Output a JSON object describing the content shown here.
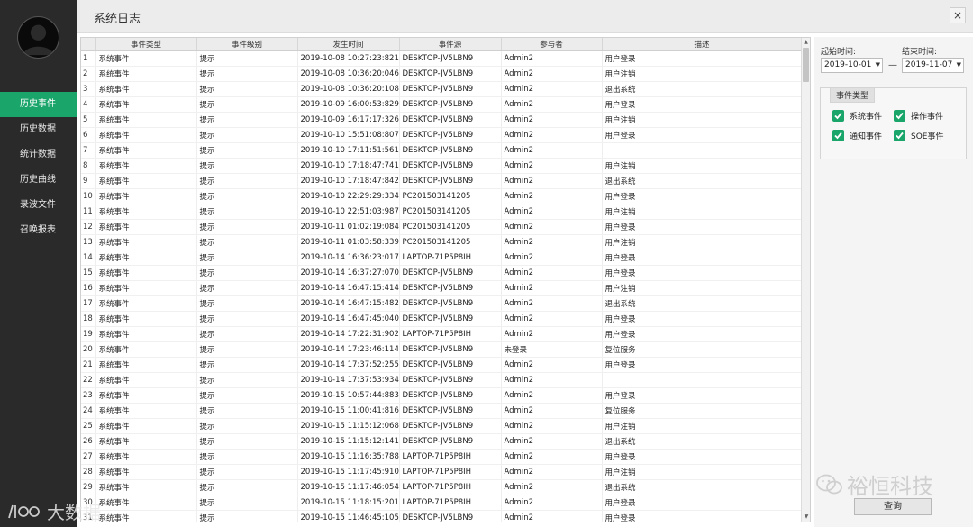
{
  "window": {
    "title": "系统日志",
    "close_label": "×"
  },
  "sidebar": {
    "items": [
      {
        "label": "历史事件",
        "active": true
      },
      {
        "label": "历史数据",
        "active": false
      },
      {
        "label": "统计数据",
        "active": false
      },
      {
        "label": "历史曲线",
        "active": false
      },
      {
        "label": "录波文件",
        "active": false
      },
      {
        "label": "召唤报表",
        "active": false
      }
    ]
  },
  "table": {
    "columns": [
      "事件类型",
      "事件级别",
      "发生时间",
      "事件源",
      "参与者",
      "描述"
    ],
    "rows": [
      [
        "1",
        "系统事件",
        "提示",
        "2019-10-08 10:27:23:821",
        "DESKTOP-JV5LBN9",
        "Admin2",
        "用户登录"
      ],
      [
        "2",
        "系统事件",
        "提示",
        "2019-10-08 10:36:20:046",
        "DESKTOP-JV5LBN9",
        "Admin2",
        "用户注销"
      ],
      [
        "3",
        "系统事件",
        "提示",
        "2019-10-08 10:36:20:108",
        "DESKTOP-JV5LBN9",
        "Admin2",
        "退出系统"
      ],
      [
        "4",
        "系统事件",
        "提示",
        "2019-10-09 16:00:53:829",
        "DESKTOP-JV5LBN9",
        "Admin2",
        "用户登录"
      ],
      [
        "5",
        "系统事件",
        "提示",
        "2019-10-09 16:17:17:326",
        "DESKTOP-JV5LBN9",
        "Admin2",
        "用户注销"
      ],
      [
        "6",
        "系统事件",
        "提示",
        "2019-10-10 15:51:08:807",
        "DESKTOP-JV5LBN9",
        "Admin2",
        "用户登录"
      ],
      [
        "7",
        "系统事件",
        "提示",
        "2019-10-10 17:11:51:561",
        "DESKTOP-JV5LBN9",
        "Admin2",
        ""
      ],
      [
        "8",
        "系统事件",
        "提示",
        "2019-10-10 17:18:47:741",
        "DESKTOP-JV5LBN9",
        "Admin2",
        "用户注销"
      ],
      [
        "9",
        "系统事件",
        "提示",
        "2019-10-10 17:18:47:842",
        "DESKTOP-JV5LBN9",
        "Admin2",
        "退出系统"
      ],
      [
        "10",
        "系统事件",
        "提示",
        "2019-10-10 22:29:29:334",
        "PC201503141205",
        "Admin2",
        "用户登录"
      ],
      [
        "11",
        "系统事件",
        "提示",
        "2019-10-10 22:51:03:987",
        "PC201503141205",
        "Admin2",
        "用户注销"
      ],
      [
        "12",
        "系统事件",
        "提示",
        "2019-10-11 01:02:19:084",
        "PC201503141205",
        "Admin2",
        "用户登录"
      ],
      [
        "13",
        "系统事件",
        "提示",
        "2019-10-11 01:03:58:339",
        "PC201503141205",
        "Admin2",
        "用户注销"
      ],
      [
        "14",
        "系统事件",
        "提示",
        "2019-10-14 16:36:23:017",
        "LAPTOP-71P5P8IH",
        "Admin2",
        "用户登录"
      ],
      [
        "15",
        "系统事件",
        "提示",
        "2019-10-14 16:37:27:070",
        "DESKTOP-JV5LBN9",
        "Admin2",
        "用户登录"
      ],
      [
        "16",
        "系统事件",
        "提示",
        "2019-10-14 16:47:15:414",
        "DESKTOP-JV5LBN9",
        "Admin2",
        "用户注销"
      ],
      [
        "17",
        "系统事件",
        "提示",
        "2019-10-14 16:47:15:482",
        "DESKTOP-JV5LBN9",
        "Admin2",
        "退出系统"
      ],
      [
        "18",
        "系统事件",
        "提示",
        "2019-10-14 16:47:45:040",
        "DESKTOP-JV5LBN9",
        "Admin2",
        "用户登录"
      ],
      [
        "19",
        "系统事件",
        "提示",
        "2019-10-14 17:22:31:902",
        "LAPTOP-71P5P8IH",
        "Admin2",
        "用户登录"
      ],
      [
        "20",
        "系统事件",
        "提示",
        "2019-10-14 17:23:46:114",
        "DESKTOP-JV5LBN9",
        "未登录",
        "复位服务"
      ],
      [
        "21",
        "系统事件",
        "提示",
        "2019-10-14 17:37:52:255",
        "DESKTOP-JV5LBN9",
        "Admin2",
        "用户登录"
      ],
      [
        "22",
        "系统事件",
        "提示",
        "2019-10-14 17:37:53:934",
        "DESKTOP-JV5LBN9",
        "Admin2",
        ""
      ],
      [
        "23",
        "系统事件",
        "提示",
        "2019-10-15 10:57:44:883",
        "DESKTOP-JV5LBN9",
        "Admin2",
        "用户登录"
      ],
      [
        "24",
        "系统事件",
        "提示",
        "2019-10-15 11:00:41:816",
        "DESKTOP-JV5LBN9",
        "Admin2",
        "复位服务"
      ],
      [
        "25",
        "系统事件",
        "提示",
        "2019-10-15 11:15:12:068",
        "DESKTOP-JV5LBN9",
        "Admin2",
        "用户注销"
      ],
      [
        "26",
        "系统事件",
        "提示",
        "2019-10-15 11:15:12:141",
        "DESKTOP-JV5LBN9",
        "Admin2",
        "退出系统"
      ],
      [
        "27",
        "系统事件",
        "提示",
        "2019-10-15 11:16:35:788",
        "LAPTOP-71P5P8IH",
        "Admin2",
        "用户登录"
      ],
      [
        "28",
        "系统事件",
        "提示",
        "2019-10-15 11:17:45:910",
        "LAPTOP-71P5P8IH",
        "Admin2",
        "用户注销"
      ],
      [
        "29",
        "系统事件",
        "提示",
        "2019-10-15 11:17:46:054",
        "LAPTOP-71P5P8IH",
        "Admin2",
        "退出系统"
      ],
      [
        "30",
        "系统事件",
        "提示",
        "2019-10-15 11:18:15:201",
        "LAPTOP-71P5P8IH",
        "Admin2",
        "用户登录"
      ],
      [
        "31",
        "系统事件",
        "提示",
        "2019-10-15 11:46:45:105",
        "DESKTOP-JV5LBN9",
        "Admin2",
        "用户登录"
      ]
    ]
  },
  "filter": {
    "start_label": "起始时间:",
    "end_label": "结束时间:",
    "start_value": "2019-10-01",
    "end_value": "2019-11-07",
    "separator": "—",
    "group_title": "事件类型",
    "checkboxes": [
      {
        "label": "系统事件",
        "checked": true
      },
      {
        "label": "操作事件",
        "checked": true
      },
      {
        "label": "通知事件",
        "checked": true
      },
      {
        "label": "SOE事件",
        "checked": true
      }
    ],
    "query_label": "查询"
  },
  "watermarks": {
    "right": "裕恒科技",
    "left": "大数据"
  },
  "colors": {
    "accent": "#1aa56b",
    "sidebar_bg": "#2a2a2a"
  }
}
